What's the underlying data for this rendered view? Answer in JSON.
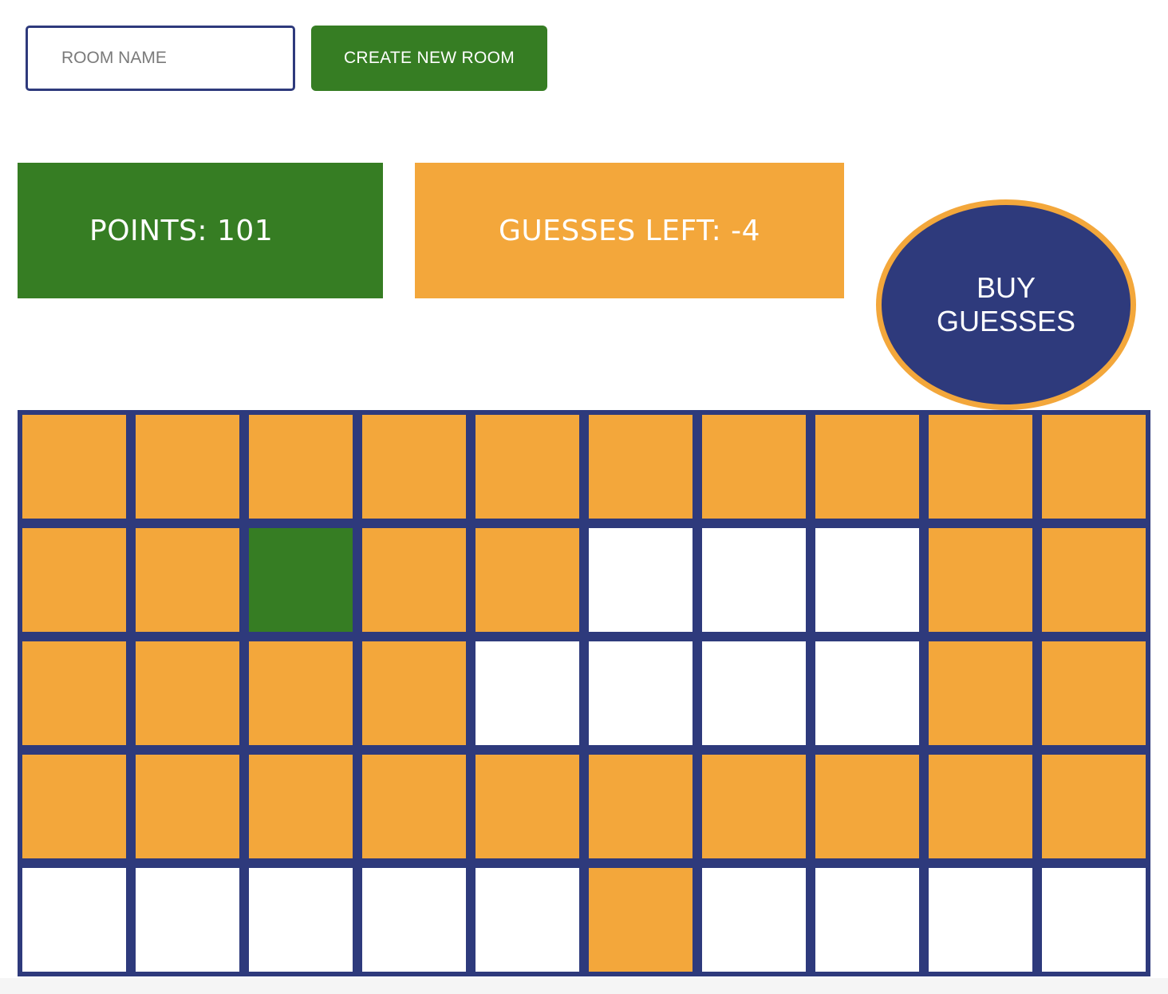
{
  "room_form": {
    "input_placeholder": "ROOM NAME",
    "input_value": "",
    "create_label": "CREATE NEW ROOM"
  },
  "stats": {
    "points_text": "POINTS: 101",
    "guesses_text": "GUESSES LEFT: -4"
  },
  "buy": {
    "line1": "BUY",
    "line2": "GUESSES"
  },
  "colors": {
    "orange": "#f3a73b",
    "green": "#367d23",
    "navy": "#2e3a7c",
    "white": "#ffffff"
  },
  "board": {
    "rows": 5,
    "cols": 10,
    "cells": [
      [
        "orange",
        "orange",
        "orange",
        "orange",
        "orange",
        "orange",
        "orange",
        "orange",
        "orange",
        "orange"
      ],
      [
        "orange",
        "orange",
        "green",
        "orange",
        "orange",
        "white",
        "white",
        "white",
        "orange",
        "orange"
      ],
      [
        "orange",
        "orange",
        "orange",
        "orange",
        "white",
        "white",
        "white",
        "white",
        "orange",
        "orange"
      ],
      [
        "orange",
        "orange",
        "orange",
        "orange",
        "orange",
        "orange",
        "orange",
        "orange",
        "orange",
        "orange"
      ],
      [
        "white",
        "white",
        "white",
        "white",
        "white",
        "orange",
        "white",
        "white",
        "white",
        "white"
      ]
    ]
  }
}
